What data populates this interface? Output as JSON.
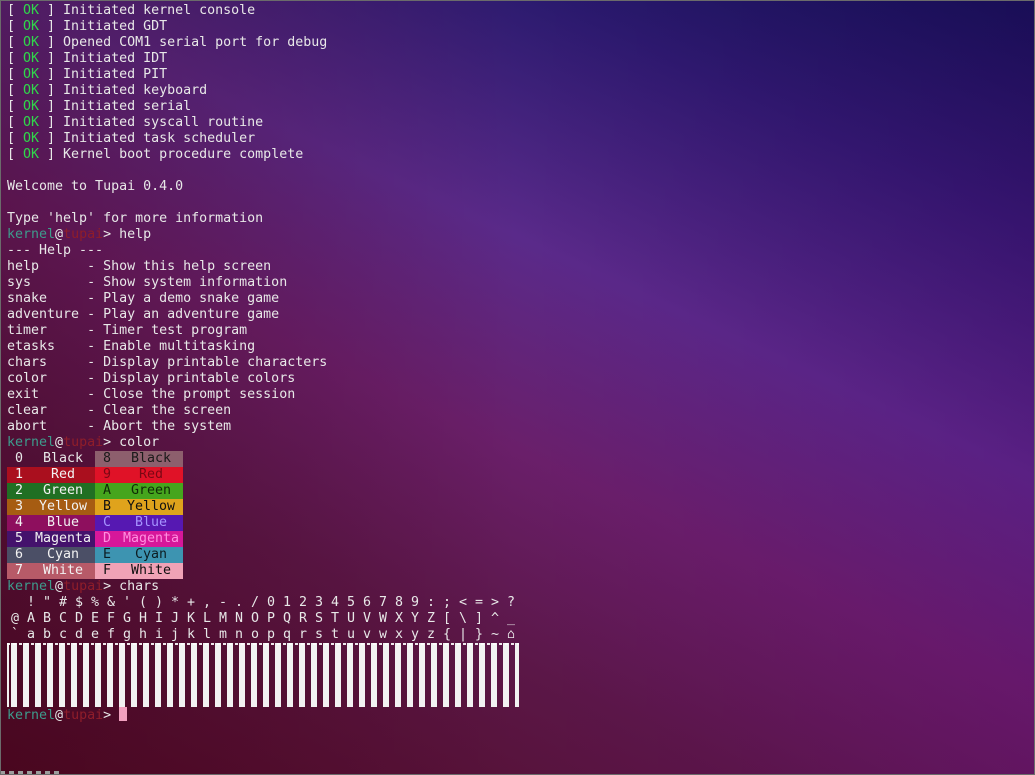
{
  "boot_log": [
    {
      "ok_open": "[ ",
      "ok_status": "OK",
      "ok_close": " ]",
      "message": " Initiated kernel console"
    },
    {
      "ok_open": "[ ",
      "ok_status": "OK",
      "ok_close": " ]",
      "message": " Initiated GDT"
    },
    {
      "ok_open": "[ ",
      "ok_status": "OK",
      "ok_close": " ]",
      "message": " Opened COM1 serial port for debug"
    },
    {
      "ok_open": "[ ",
      "ok_status": "OK",
      "ok_close": " ]",
      "message": " Initiated IDT"
    },
    {
      "ok_open": "[ ",
      "ok_status": "OK",
      "ok_close": " ]",
      "message": " Initiated PIT"
    },
    {
      "ok_open": "[ ",
      "ok_status": "OK",
      "ok_close": " ]",
      "message": " Initiated keyboard"
    },
    {
      "ok_open": "[ ",
      "ok_status": "OK",
      "ok_close": " ]",
      "message": " Initiated serial"
    },
    {
      "ok_open": "[ ",
      "ok_status": "OK",
      "ok_close": " ]",
      "message": " Initiated syscall routine"
    },
    {
      "ok_open": "[ ",
      "ok_status": "OK",
      "ok_close": " ]",
      "message": " Initiated task scheduler"
    },
    {
      "ok_open": "[ ",
      "ok_status": "OK",
      "ok_close": " ]",
      "message": " Kernel boot procedure complete"
    }
  ],
  "welcome": "Welcome to Tupai 0.4.0",
  "help_hint": "Type 'help' for more information",
  "prompt": {
    "user": "kernel",
    "at": "@",
    "host": "tupai",
    "symbol": "> "
  },
  "commands_entered": {
    "first": "help",
    "second": "color",
    "third": "chars"
  },
  "help": {
    "title": "--- Help ---",
    "items": [
      {
        "cmd": "help      ",
        "desc": "- Show this help screen"
      },
      {
        "cmd": "sys       ",
        "desc": "- Show system information"
      },
      {
        "cmd": "snake     ",
        "desc": "- Play a demo snake game"
      },
      {
        "cmd": "adventure ",
        "desc": "- Play an adventure game"
      },
      {
        "cmd": "timer     ",
        "desc": "- Timer test program"
      },
      {
        "cmd": "etasks    ",
        "desc": "- Enable multitasking"
      },
      {
        "cmd": "chars     ",
        "desc": "- Display printable characters"
      },
      {
        "cmd": "color     ",
        "desc": "- Display printable colors"
      },
      {
        "cmd": "exit      ",
        "desc": "- Close the prompt session"
      },
      {
        "cmd": "clear     ",
        "desc": "- Clear the screen"
      },
      {
        "cmd": "abort     ",
        "desc": "- Abort the system"
      }
    ]
  },
  "palette": [
    {
      "left": {
        "num": "0",
        "name": "Black",
        "bg": "rgba(0,0,0,0)",
        "fg": "#e8e8e8"
      },
      "right": {
        "num": "8",
        "name": "Black",
        "bg": "#8d5f6d",
        "fg": "#1a1a1a"
      }
    },
    {
      "left": {
        "num": "1",
        "name": "Red",
        "bg": "#aa0f1e",
        "fg": "#f2f2f2"
      },
      "right": {
        "num": "9",
        "name": "Red",
        "bg": "#e01227",
        "fg": "#7a0714"
      }
    },
    {
      "left": {
        "num": "2",
        "name": "Green",
        "bg": "#206f23",
        "fg": "#f2f2f2"
      },
      "right": {
        "num": "A",
        "name": "Green",
        "bg": "#45a51d",
        "fg": "#0f2a06"
      }
    },
    {
      "left": {
        "num": "3",
        "name": "Yellow",
        "bg": "#a65c12",
        "fg": "#f2f2f2"
      },
      "right": {
        "num": "B",
        "name": "Yellow",
        "bg": "#dfa31c",
        "fg": "#111111"
      }
    },
    {
      "left": {
        "num": "4",
        "name": "Blue",
        "bg": "#8e0f5e",
        "fg": "#f2f2f2"
      },
      "right": {
        "num": "C",
        "name": "Blue",
        "bg": "#5618b2",
        "fg": "#a593ff"
      }
    },
    {
      "left": {
        "num": "5",
        "name": "Magenta",
        "bg": "#44126c",
        "fg": "#f2f2f2"
      },
      "right": {
        "num": "D",
        "name": "Magenta",
        "bg": "#d7179a",
        "fg": "#ff8fe0"
      }
    },
    {
      "left": {
        "num": "6",
        "name": "Cyan",
        "bg": "#4b4f66",
        "fg": "#f2f2f2"
      },
      "right": {
        "num": "E",
        "name": "Cyan",
        "bg": "#3d94b1",
        "fg": "#0d1c22"
      }
    },
    {
      "left": {
        "num": "7",
        "name": "White",
        "bg": "#b75a68",
        "fg": "#f2f2f2"
      },
      "right": {
        "num": "F",
        "name": "White",
        "bg": "#f0a2b6",
        "fg": "#101010"
      }
    }
  ],
  "chars_rows": [
    [
      " ",
      "!",
      "\"",
      "#",
      "$",
      "%",
      "&",
      "'",
      "(",
      ")",
      "*",
      "+",
      ",",
      "-",
      ".",
      "/",
      "0",
      "1",
      "2",
      "3",
      "4",
      "5",
      "6",
      "7",
      "8",
      "9",
      ":",
      ";",
      "<",
      "=",
      ">",
      "?"
    ],
    [
      "@",
      "A",
      "B",
      "C",
      "D",
      "E",
      "F",
      "G",
      "H",
      "I",
      "J",
      "K",
      "L",
      "M",
      "N",
      "O",
      "P",
      "Q",
      "R",
      "S",
      "T",
      "U",
      "V",
      "W",
      "X",
      "Y",
      "Z",
      "[",
      "\\",
      "]",
      "^",
      "_"
    ],
    [
      "`",
      "a",
      "b",
      "c",
      "d",
      "e",
      "f",
      "g",
      "h",
      "i",
      "j",
      "k",
      "l",
      "m",
      "n",
      "o",
      "p",
      "q",
      "r",
      "s",
      "t",
      "u",
      "v",
      "w",
      "x",
      "y",
      "z",
      "{",
      "|",
      "}",
      "~",
      "⌂"
    ]
  ],
  "colors": {
    "ok": "#2fd84a",
    "prompt_user": "#3e9b8c",
    "prompt_host": "#8f1d2a",
    "cursor": "#f2a0bf",
    "text": "#e8e8e8"
  }
}
